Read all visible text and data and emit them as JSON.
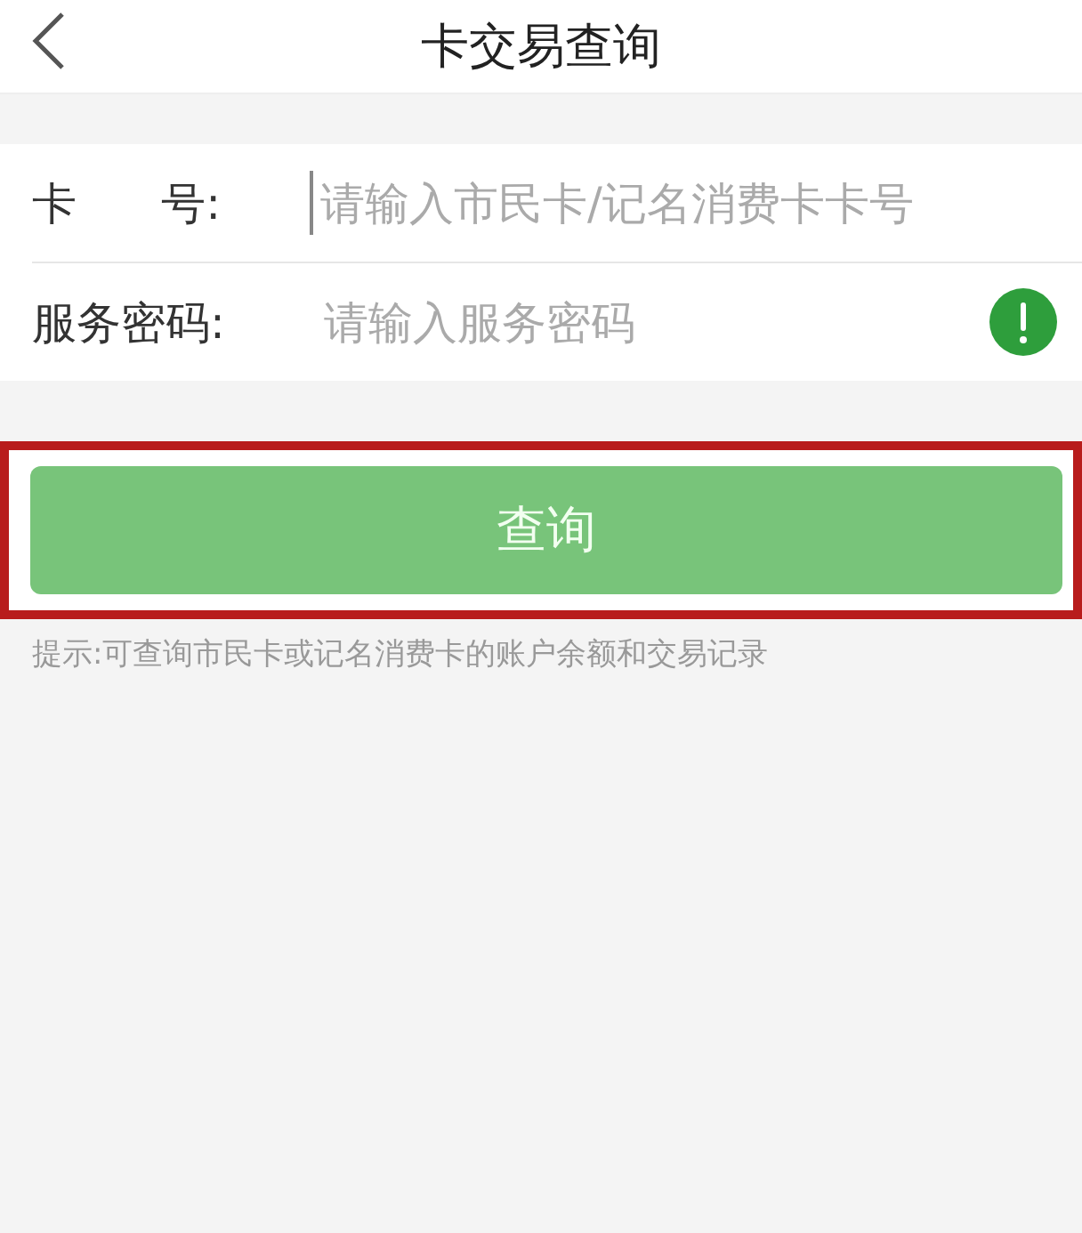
{
  "header": {
    "title": "卡交易查询"
  },
  "fields": [
    {
      "label": "卡      号:",
      "placeholder": "请输入市民卡/记名消费卡卡号",
      "focused": true,
      "kind": "text"
    },
    {
      "label": "服务密码:",
      "placeholder": "请输入服务密码",
      "focused": false,
      "kind": "password"
    }
  ],
  "query_button": {
    "label": "查询",
    "highlighted": true
  },
  "hint": "提示:可查询市民卡或记名消费卡的账户余额和交易记录"
}
